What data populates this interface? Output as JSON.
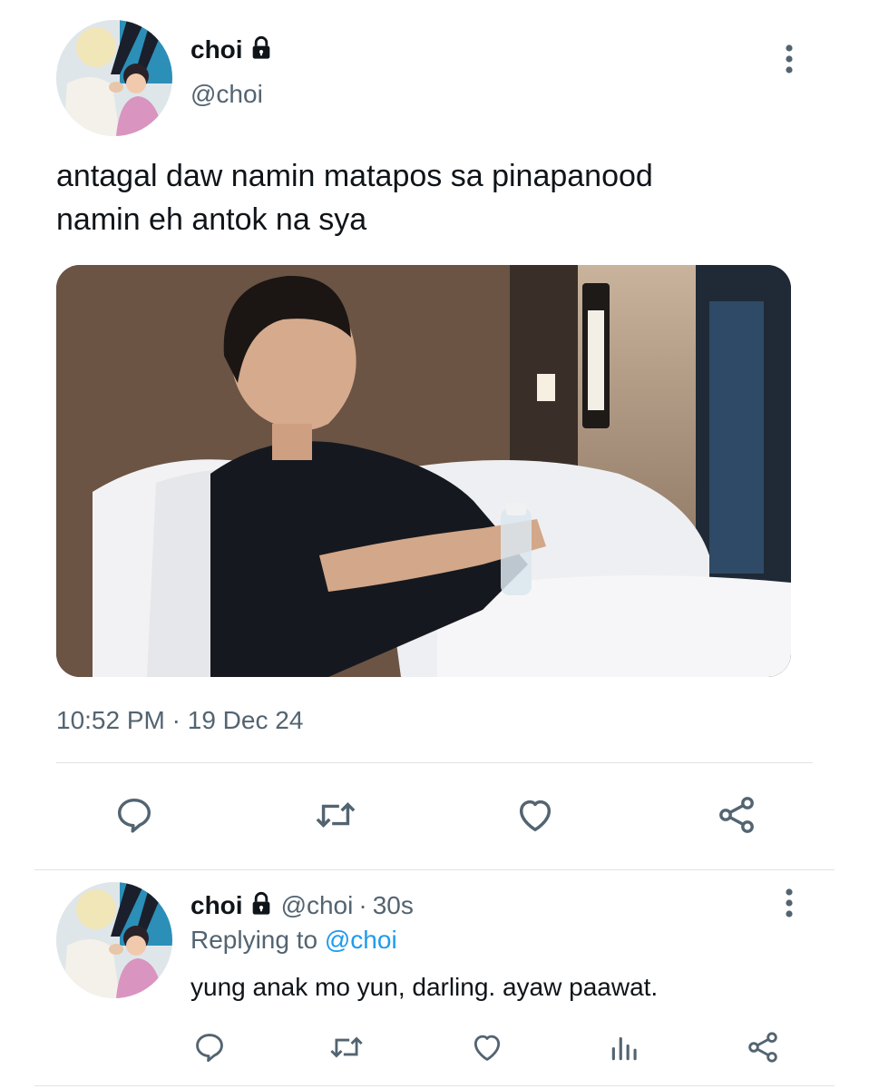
{
  "tweet": {
    "display_name": "choi",
    "handle": "@choi",
    "text_line1": "antagal daw namin matapos sa pinapanood",
    "text_line2": "namin eh antok na sya",
    "time": "10:52 PM",
    "separator": "·",
    "date": "19 Dec 24"
  },
  "reply": {
    "display_name": "choi",
    "handle": "@choi",
    "separator": "·",
    "age": "30s",
    "replying_label": "Replying to",
    "replying_handle": "@choi",
    "text": "yung anak mo yun, darling. ayaw paawat."
  },
  "icons": {
    "more": "more-vertical-icon",
    "lock": "lock-icon",
    "reply": "reply-icon",
    "retweet": "retweet-icon",
    "like": "heart-icon",
    "share": "share-icon",
    "views": "views-icon"
  },
  "colors": {
    "text": "#0f1419",
    "secondary": "#536471",
    "link": "#1d9bf0",
    "divider": "#dfe4e8"
  }
}
